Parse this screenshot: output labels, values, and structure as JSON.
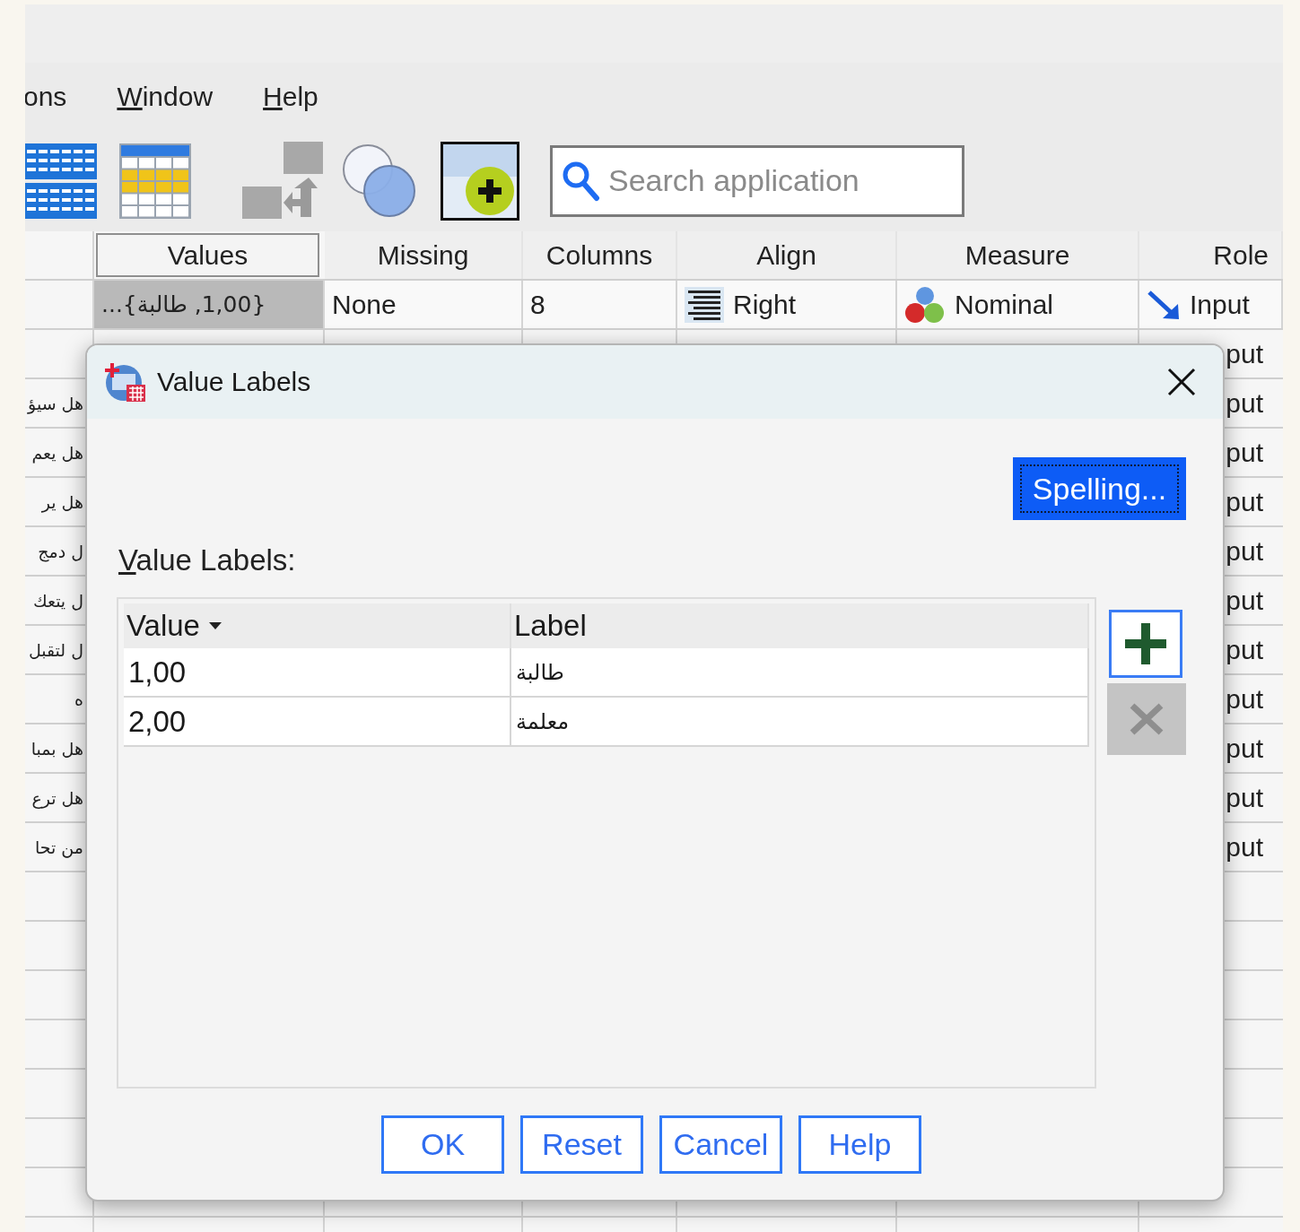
{
  "menu": [
    {
      "label": "ons",
      "mnemonic": false
    },
    {
      "label": "Window",
      "mnemonic": true
    },
    {
      "label": "Help",
      "mnemonic": true
    }
  ],
  "toolbar": {
    "search": {
      "placeholder": "Search application"
    }
  },
  "grid": {
    "columns": [
      {
        "label": "Values",
        "selected": true
      },
      {
        "label": "Missing",
        "selected": false
      },
      {
        "label": "Columns",
        "selected": false
      },
      {
        "label": "Align",
        "selected": false
      },
      {
        "label": "Measure",
        "selected": false
      },
      {
        "label": "Role",
        "selected": false
      }
    ],
    "first_row": [
      {
        "kind": "values",
        "text": "{1,00, طالبة}...",
        "selected": true
      },
      {
        "kind": "text",
        "text": "None",
        "selected": false
      },
      {
        "kind": "text",
        "text": "8",
        "selected": false
      },
      {
        "kind": "align",
        "text": "Right",
        "selected": false
      },
      {
        "kind": "measure",
        "text": "Nominal",
        "selected": false
      },
      {
        "kind": "role",
        "text": "Input",
        "selected": false
      }
    ],
    "partial_rows": [
      {
        "role": "put"
      },
      {
        "name": "هل سيؤ",
        "role": "put"
      },
      {
        "name": "هل يعم",
        "role": "put"
      },
      {
        "name": "هل ير",
        "role": "put"
      },
      {
        "name": "ل دمج",
        "role": "put"
      },
      {
        "name": "ل يتعك",
        "role": "put"
      },
      {
        "name": "ل لتقبل",
        "role": "put"
      },
      {
        "name": "ه",
        "role": "put"
      },
      {
        "name": "هل بمبا",
        "role": "put"
      },
      {
        "name": "هل ترع",
        "role": "put"
      },
      {
        "name": "من تحا",
        "role": "put"
      }
    ]
  },
  "dialog": {
    "title": "Value Labels",
    "spelling_button": {
      "label": "Spelling...",
      "focused": true
    },
    "list_label": {
      "text": "Value Labels:",
      "mnemonic": true
    },
    "table": {
      "columns": [
        {
          "label": "Value",
          "sorted": true
        },
        {
          "label": "Label",
          "sorted": false
        }
      ],
      "rows": [
        {
          "value": "1,00",
          "label": "طالبة"
        },
        {
          "value": "2,00",
          "label": "معلمة"
        }
      ]
    },
    "add_button": {
      "disabled": false
    },
    "remove_button": {
      "disabled": true
    },
    "buttons": [
      "OK",
      "Reset",
      "Cancel",
      "Help"
    ]
  }
}
